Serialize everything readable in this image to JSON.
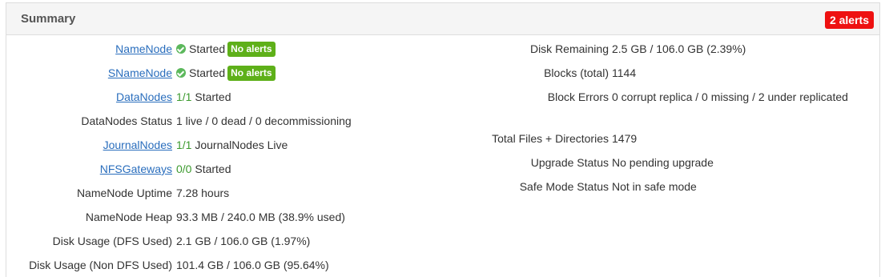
{
  "panel": {
    "title": "Summary",
    "alerts_badge": "2 alerts"
  },
  "left": {
    "namenode": {
      "label": "NameNode",
      "status": "Started",
      "badge": "No alerts"
    },
    "snamenode": {
      "label": "SNameNode",
      "status": "Started",
      "badge": "No alerts"
    },
    "datanodes": {
      "label": "DataNodes",
      "count": "1/1",
      "status": "Started"
    },
    "datanodes_status": {
      "label": "DataNodes Status",
      "value": "1 live / 0 dead / 0 decommissioning"
    },
    "journalnodes": {
      "label": "JournalNodes",
      "count": "1/1",
      "status": "JournalNodes Live"
    },
    "nfsgateways": {
      "label": "NFSGateways",
      "count": "0/0",
      "status": "Started"
    },
    "namenode_uptime": {
      "label": "NameNode Uptime",
      "value": "7.28 hours"
    },
    "namenode_heap": {
      "label": "NameNode Heap",
      "value": "93.3 MB / 240.0 MB (38.9% used)"
    },
    "disk_usage_dfs": {
      "label": "Disk Usage (DFS Used)",
      "value": "2.1 GB / 106.0 GB (1.97%)"
    },
    "disk_usage_non_dfs": {
      "label": "Disk Usage (Non DFS Used)",
      "value": "101.4 GB / 106.0 GB (95.64%)"
    }
  },
  "right": {
    "disk_remaining": {
      "label": "Disk Remaining",
      "value": "2.5 GB / 106.0 GB (2.39%)"
    },
    "blocks_total": {
      "label": "Blocks (total)",
      "value": "1144"
    },
    "block_errors": {
      "label": "Block Errors",
      "value": "0 corrupt replica / 0 missing / 2 under replicated"
    },
    "total_files": {
      "label": "Total Files + Directories",
      "value": "1479"
    },
    "upgrade_status": {
      "label": "Upgrade Status",
      "value": "No pending upgrade"
    },
    "safe_mode_status": {
      "label": "Safe Mode Status",
      "value": "Not in safe mode"
    }
  },
  "icons": {
    "status_ok": "check-circle-icon"
  },
  "colors": {
    "link": "#2a6ebd",
    "ok_green": "#5eb019",
    "alert_red": "#ee1111",
    "count_green": "#3c9a2e"
  }
}
